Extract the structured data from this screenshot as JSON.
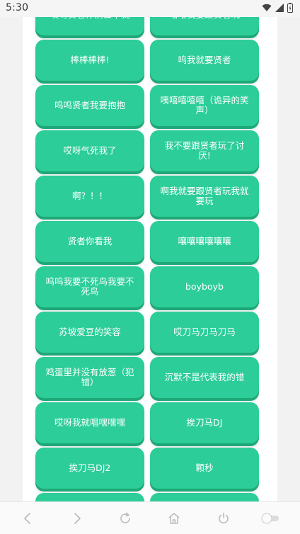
{
  "status_bar": {
    "time": "5:30"
  },
  "sound_buttons": [
    "哎呀贤者你别去干我",
    "哈哈我要跟贤者玩",
    "棒棒棒棒!",
    "呜我就要贤者",
    "呜呜贤者我要抱抱",
    "咦嘻嘻嘻嘻（诡异的笑声）",
    "哎呀气死我了",
    "我不要跟贤者玩了讨厌!",
    "啊？！！",
    "啊我就要跟贤者玩我就要玩",
    "贤者你看我",
    "嚷嚷嚷嚷嚷嚷",
    "呜呜我要不死鸟我要不死鸟",
    "boyboyb",
    "苏坡爱豆的笑容",
    "哎刀马刀马刀马",
    "鸡蛋里并没有放葱（犯错）",
    "沉默不是代表我的错",
    "哎呀我就唱嘿嘿嘿",
    "挨刀马DJ",
    "挨刀马DJ2",
    "颗秒",
    "",
    ""
  ],
  "colors": {
    "button": "#2ccd98",
    "button_shadow": "#1ea878",
    "panel": "#ffffff",
    "background": "#f2f2f2"
  },
  "bottom_nav": {
    "icons": [
      "back-arrow-icon",
      "forward-arrow-icon",
      "reload-icon",
      "home-icon",
      "power-icon",
      "toggle-switch-icon"
    ]
  }
}
